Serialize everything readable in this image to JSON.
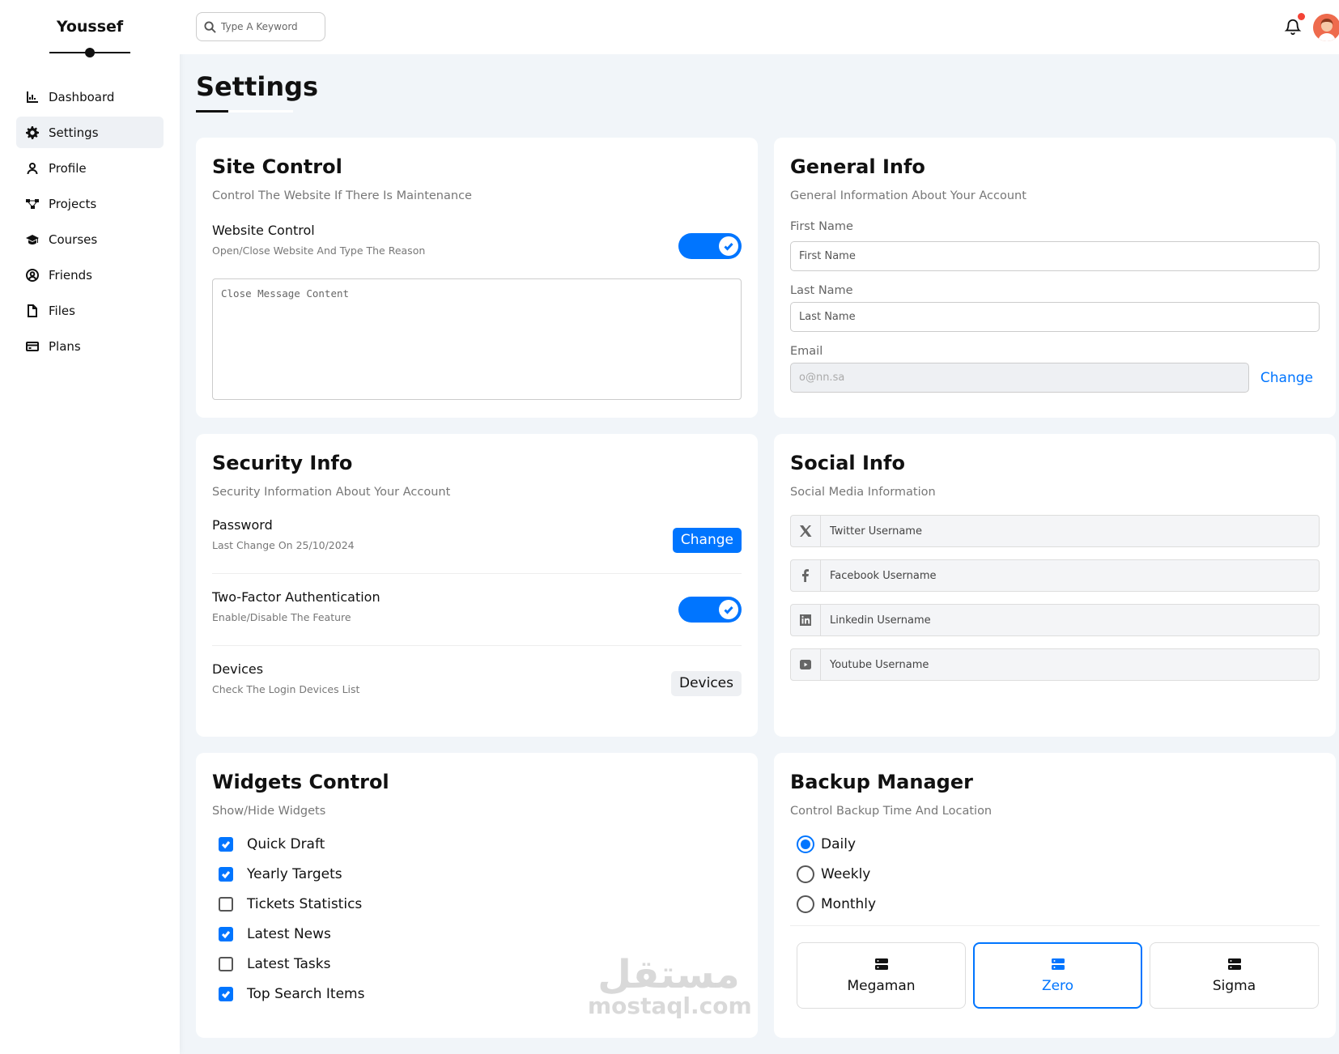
{
  "sidebar": {
    "brand": "Youssef",
    "items": [
      {
        "label": "Dashboard",
        "icon": "chart-icon"
      },
      {
        "label": "Settings",
        "icon": "gear-icon"
      },
      {
        "label": "Profile",
        "icon": "user-icon"
      },
      {
        "label": "Projects",
        "icon": "diagram-icon"
      },
      {
        "label": "Courses",
        "icon": "graduation-cap-icon"
      },
      {
        "label": "Friends",
        "icon": "user-circle-icon"
      },
      {
        "label": "Files",
        "icon": "file-icon"
      },
      {
        "label": "Plans",
        "icon": "credit-card-icon"
      }
    ],
    "active": "Settings"
  },
  "topbar": {
    "search_placeholder": "Type A Keyword"
  },
  "page": {
    "title": "Settings"
  },
  "site_control": {
    "title": "Site Control",
    "subtitle": "Control The Website If There Is Maintenance",
    "website_control_title": "Website Control",
    "website_control_sub": "Open/Close Website And Type The Reason",
    "website_control_on": true,
    "message_placeholder": "Close Message Content"
  },
  "general_info": {
    "title": "General Info",
    "subtitle": "General Information About Your Account",
    "first_name_label": "First Name",
    "first_name_placeholder": "First Name",
    "last_name_label": "Last Name",
    "last_name_placeholder": "Last Name",
    "email_label": "Email",
    "email_placeholder": "o@nn.sa",
    "email_change": "Change"
  },
  "security_info": {
    "title": "Security Info",
    "subtitle": "Security Information About Your Account",
    "password_title": "Password",
    "password_sub": "Last Change On 25/10/2024",
    "password_button": "Change",
    "twofa_title": "Two-Factor Authentication",
    "twofa_sub": "Enable/Disable The Feature",
    "twofa_on": true,
    "devices_title": "Devices",
    "devices_sub": "Check The Login Devices List",
    "devices_button": "Devices"
  },
  "social_info": {
    "title": "Social Info",
    "subtitle": "Social Media Information",
    "fields": [
      {
        "icon": "x-twitter-icon",
        "placeholder": "Twitter Username"
      },
      {
        "icon": "facebook-icon",
        "placeholder": "Facebook Username"
      },
      {
        "icon": "linkedin-icon",
        "placeholder": "Linkedin Username"
      },
      {
        "icon": "youtube-icon",
        "placeholder": "Youtube Username"
      }
    ]
  },
  "widgets_control": {
    "title": "Widgets Control",
    "subtitle": "Show/Hide Widgets",
    "items": [
      {
        "label": "Quick Draft",
        "checked": true
      },
      {
        "label": "Yearly Targets",
        "checked": true
      },
      {
        "label": "Tickets Statistics",
        "checked": false
      },
      {
        "label": "Latest News",
        "checked": true
      },
      {
        "label": "Latest Tasks",
        "checked": false
      },
      {
        "label": "Top Search Items",
        "checked": true
      }
    ]
  },
  "backup_manager": {
    "title": "Backup Manager",
    "subtitle": "Control Backup Time And Location",
    "options": [
      {
        "label": "Daily",
        "selected": true
      },
      {
        "label": "Weekly",
        "selected": false
      },
      {
        "label": "Monthly",
        "selected": false
      }
    ],
    "servers": [
      {
        "label": "Megaman",
        "selected": false
      },
      {
        "label": "Zero",
        "selected": true
      },
      {
        "label": "Sigma",
        "selected": false
      }
    ]
  },
  "watermark": {
    "arabic": "مستقل",
    "latin": "mostaql.com"
  },
  "colors": {
    "accent": "#0075ff",
    "background": "#f1f5f9",
    "notification": "#f44336"
  }
}
